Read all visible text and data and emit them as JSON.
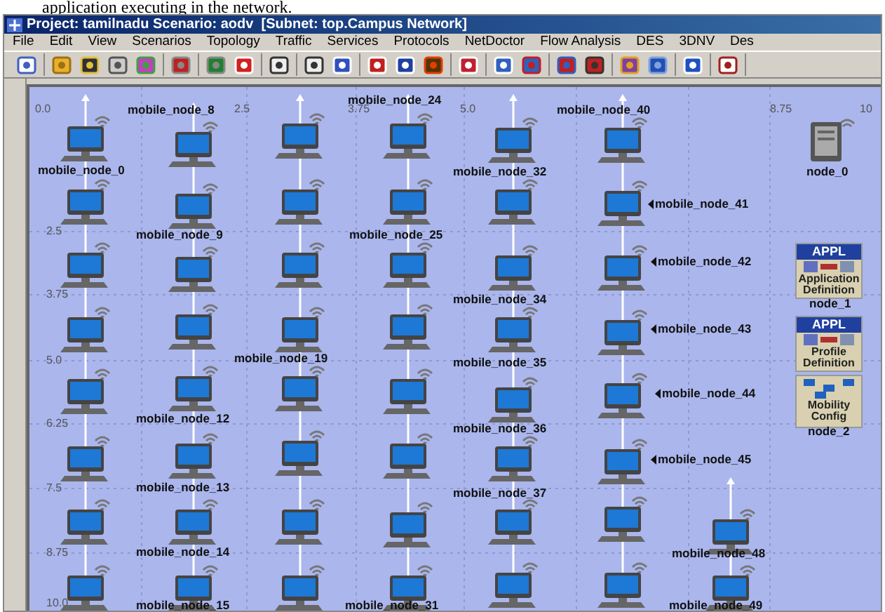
{
  "caption": "application executing in the network.",
  "window": {
    "title": "Project: tamilnadu Scenario: aodv  [Subnet: top.Campus Network]"
  },
  "menu": [
    "File",
    "Edit",
    "View",
    "Scenarios",
    "Topology",
    "Traffic",
    "Services",
    "Protocols",
    "NetDoctor",
    "Flow Analysis",
    "DES",
    "3DNV",
    "Des"
  ],
  "canvas": {
    "x_ticks": [
      "0.0",
      "2.5",
      "3.75",
      "5.0",
      "8.75",
      "10"
    ],
    "y_ticks": [
      "2.5",
      "3.75",
      "5.0",
      "6.25",
      "7.5",
      "8.75",
      "10.0"
    ],
    "labels": [
      {
        "text": "mobile_node_0",
        "kind": "plain"
      },
      {
        "text": "mobile_node_8",
        "kind": "plain"
      },
      {
        "text": "mobile_node_24",
        "kind": "plain"
      },
      {
        "text": "mobile_node_40",
        "kind": "plain"
      },
      {
        "text": "mobile_node_32",
        "kind": "plain"
      },
      {
        "text": "node_0",
        "kind": "plain"
      },
      {
        "text": "mobile_node_9",
        "kind": "plain"
      },
      {
        "text": "mobile_node_25",
        "kind": "plain"
      },
      {
        "text": "mobile_node_41",
        "kind": "pointer"
      },
      {
        "text": "mobile_node_42",
        "kind": "pointer"
      },
      {
        "text": "mobile_node_34",
        "kind": "plain"
      },
      {
        "text": "node_1",
        "kind": "plain"
      },
      {
        "text": "mobile_node_19",
        "kind": "plain"
      },
      {
        "text": "mobile_node_43",
        "kind": "pointer"
      },
      {
        "text": "mobile_node_35",
        "kind": "plain"
      },
      {
        "text": "mobile_node_12",
        "kind": "plain"
      },
      {
        "text": "mobile_node_44",
        "kind": "pointer"
      },
      {
        "text": "mobile_node_36",
        "kind": "plain"
      },
      {
        "text": "node_2",
        "kind": "plain"
      },
      {
        "text": "mobile_node_45",
        "kind": "pointer"
      },
      {
        "text": "mobile_node_13",
        "kind": "plain"
      },
      {
        "text": "mobile_node_37",
        "kind": "plain"
      },
      {
        "text": "mobile_node_14",
        "kind": "plain"
      },
      {
        "text": "mobile_node_48",
        "kind": "plain"
      },
      {
        "text": "mobile_node_15",
        "kind": "plain"
      },
      {
        "text": "mobile_node_31",
        "kind": "plain"
      },
      {
        "text": "mobile_node_49",
        "kind": "plain"
      }
    ],
    "special_nodes": [
      {
        "kind": "server"
      },
      {
        "kind": "config",
        "badge": "APPL",
        "caption": "Application Definition"
      },
      {
        "kind": "config",
        "badge": "APPL",
        "caption": "Profile Definition"
      },
      {
        "kind": "mobility",
        "caption": "Mobility Config"
      }
    ]
  }
}
